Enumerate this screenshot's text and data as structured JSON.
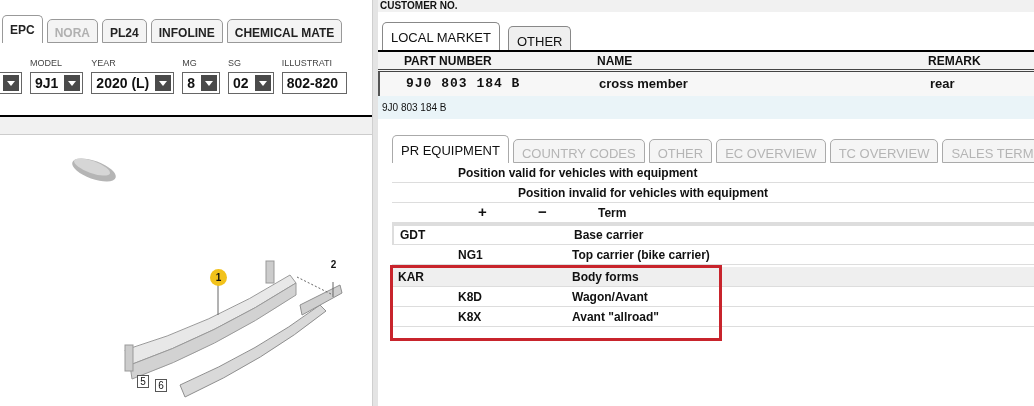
{
  "left_panel": {
    "tabs": [
      {
        "label": "EPC",
        "selected": true,
        "disabled": false
      },
      {
        "label": "NORA",
        "selected": false,
        "disabled": true
      },
      {
        "label": "PL24",
        "selected": false,
        "disabled": false
      },
      {
        "label": "INFOLINE",
        "selected": false,
        "disabled": false
      },
      {
        "label": "CHEMICAL MATE",
        "selected": false,
        "disabled": false
      }
    ],
    "fields": [
      {
        "kind": "select"
      },
      {
        "kind": "select",
        "label": "MODEL",
        "value": "9J1"
      },
      {
        "kind": "select",
        "label": "YEAR",
        "value": "2020 (L)"
      },
      {
        "kind": "select",
        "label": "MG",
        "value": "8"
      },
      {
        "kind": "select",
        "label": "SG",
        "value": "02"
      },
      {
        "kind": "text",
        "label": "ILLUSTRATI",
        "value": "802-820"
      }
    ],
    "illustration": {
      "callouts": [
        {
          "label": "1",
          "kind": "highlighted"
        },
        {
          "label": "2",
          "kind": "plain"
        },
        {
          "label": "5",
          "kind": "boxed"
        },
        {
          "label": "6",
          "kind": "boxed"
        }
      ]
    }
  },
  "right_panel": {
    "header_label": "CUSTOMER NO.",
    "tabs": [
      {
        "label": "LOCAL MARKET",
        "selected": true
      },
      {
        "label": "OTHER",
        "selected": false
      }
    ],
    "parts_table": {
      "columns": [
        "PART NUMBER",
        "NAME",
        "REMARK"
      ],
      "rows": [
        {
          "part_number": "9J0 803 184 B",
          "name": "cross member",
          "remark": "rear"
        }
      ]
    },
    "selected_part": "9J0 803 184 B",
    "detail_tabs": [
      {
        "label": "PR EQUIPMENT",
        "selected": true,
        "disabled": false
      },
      {
        "label": "COUNTRY CODES",
        "selected": false,
        "disabled": true
      },
      {
        "label": "OTHER",
        "selected": false,
        "disabled": true
      },
      {
        "label": "EC OVERVIEW",
        "selected": false,
        "disabled": true
      },
      {
        "label": "TC OVERVIEW",
        "selected": false,
        "disabled": true
      },
      {
        "label": "SALES TERM",
        "selected": false,
        "disabled": true
      }
    ],
    "pr_headers": {
      "valid": "Position valid for vehicles with equipment",
      "invalid": "Position invalid for vehicles with equipment",
      "plus": "+",
      "minus": "−",
      "term": "Term"
    },
    "pr_rows": [
      {
        "kind": "group",
        "code": "GDT",
        "term": "Base carrier",
        "selected": true
      },
      {
        "kind": "item",
        "code": "NG1",
        "term": "Top carrier (bike carrier)",
        "selected": false
      },
      {
        "kind": "highlight",
        "children": [
          {
            "kind": "group",
            "code": "KAR",
            "term": "Body forms",
            "selected": false
          },
          {
            "kind": "item",
            "code": "K8D",
            "term": "Wagon/Avant",
            "selected": false
          },
          {
            "kind": "item",
            "code": "K8X",
            "term": "Avant \"allroad\"",
            "selected": false
          }
        ]
      }
    ]
  }
}
